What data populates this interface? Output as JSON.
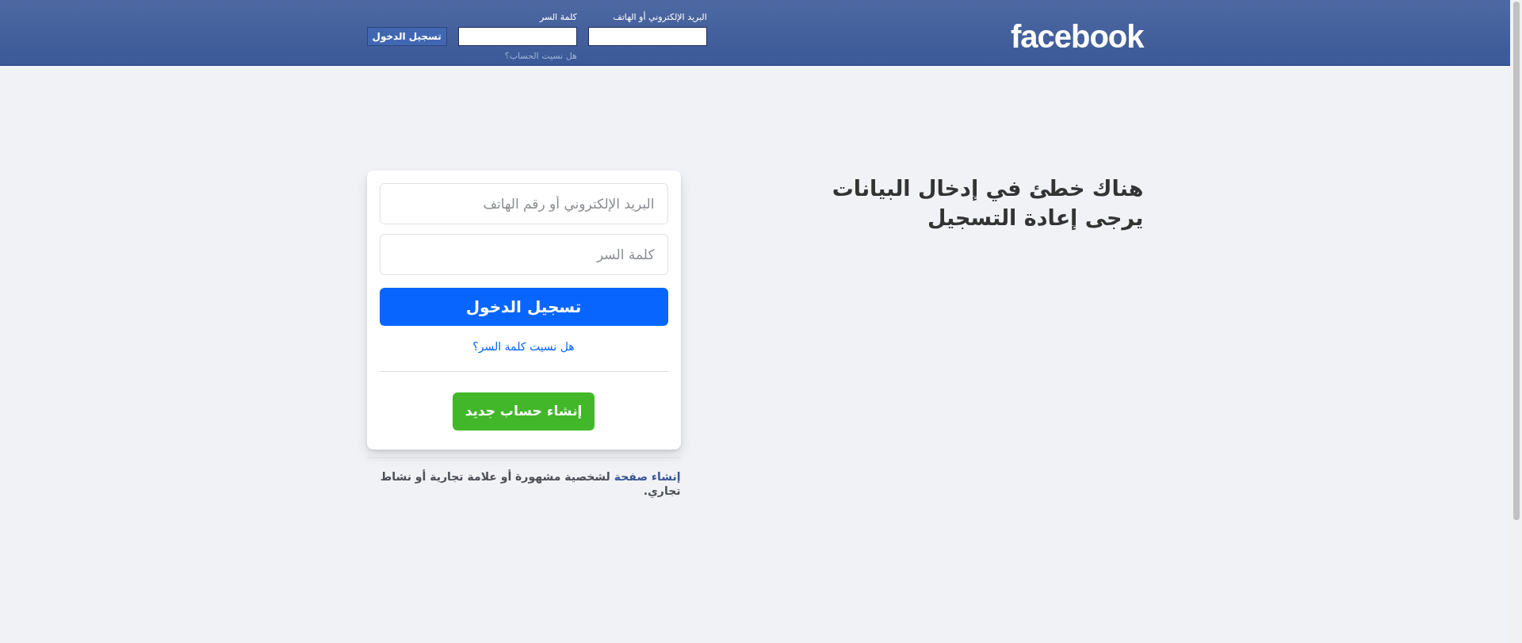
{
  "header": {
    "logo": "facebook",
    "email_label": "البريد الإلكتروني أو الهاتف",
    "password_label": "كلمة السر",
    "login_button": "تسجيل الدخول",
    "forgot_link": "هل نسيت الحساب؟"
  },
  "message": {
    "lines": [
      "هناك خطئ في إدخال البيانات",
      "يرجى إعادة التسجيل"
    ]
  },
  "login_card": {
    "email_placeholder": "البريد الإلكتروني أو رقم الهاتف",
    "password_placeholder": "كلمة السر",
    "login_button": "تسجيل الدخول",
    "forgot_link": "هل نسيت كلمة السر؟",
    "create_button": "إنشاء حساب جديد"
  },
  "footer": {
    "link": "إنشاء صفحة",
    "text": "لشخصية مشهورة أو علامة تجارية أو نشاط تجاري."
  }
}
